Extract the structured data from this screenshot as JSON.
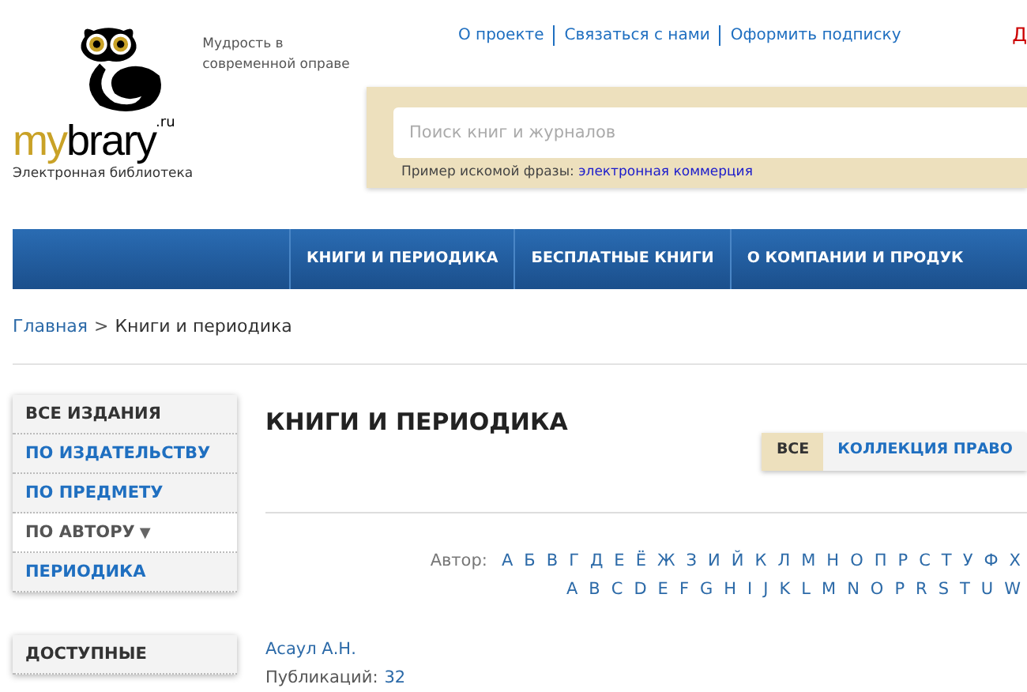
{
  "logo": {
    "tagline": "Мудрость в современной оправе",
    "wordmark_left": "my",
    "wordmark_right": "brary",
    "domain": ".ru",
    "subtitle": "Электронная библиотека"
  },
  "top_links": [
    "О проекте",
    "Связаться с нами",
    "Оформить подписку"
  ],
  "top_right_cut": "Д",
  "search": {
    "placeholder": "Поиск книг и журналов",
    "example_label": "Пример искомой фразы:",
    "example_link": "электронная коммерция"
  },
  "nav": [
    "КНИГИ И ПЕРИОДИКА",
    "БЕСПЛАТНЫЕ КНИГИ",
    "О КОМПАНИИ И ПРОДУК"
  ],
  "breadcrumb": {
    "link": "Главная",
    "separator": ">",
    "current": "Книги и периодика"
  },
  "sidebar": [
    {
      "label": "ВСЕ ИЗДАНИЯ",
      "selected": true,
      "kind": "link"
    },
    {
      "label": "ПО ИЗДАТЕЛЬСТВУ",
      "selected": false,
      "kind": "link"
    },
    {
      "label": "ПО ПРЕДМЕТУ",
      "selected": false,
      "kind": "link"
    },
    {
      "label": "ПО АВТОРУ",
      "selected": true,
      "kind": "dropdown",
      "caret": "▼"
    },
    {
      "label": "ПЕРИОДИКА",
      "selected": false,
      "kind": "link"
    }
  ],
  "sidebar_2": [
    {
      "label": "ДОСТУПНЫЕ",
      "selected": true
    }
  ],
  "page_title": "КНИГИ И ПЕРИОДИКА",
  "filter_tabs": [
    {
      "label": "ВСЕ",
      "selected": true
    },
    {
      "label": "КОЛЛЕКЦИЯ ПРАВО",
      "selected": false
    }
  ],
  "author_filter": {
    "label": "Автор:",
    "cyrillic": [
      "А",
      "Б",
      "В",
      "Г",
      "Д",
      "Е",
      "Ё",
      "Ж",
      "З",
      "И",
      "Й",
      "К",
      "Л",
      "М",
      "Н",
      "О",
      "П",
      "Р",
      "С",
      "Т",
      "У",
      "Ф",
      "Х"
    ],
    "latin": [
      "A",
      "B",
      "C",
      "D",
      "E",
      "F",
      "G",
      "H",
      "I",
      "J",
      "K",
      "L",
      "M",
      "N",
      "O",
      "P",
      "R",
      "S",
      "T",
      "U",
      "W"
    ]
  },
  "authors": [
    {
      "name": "Асаул А.Н.",
      "count_label": "Публикаций:",
      "count": "32"
    }
  ]
}
